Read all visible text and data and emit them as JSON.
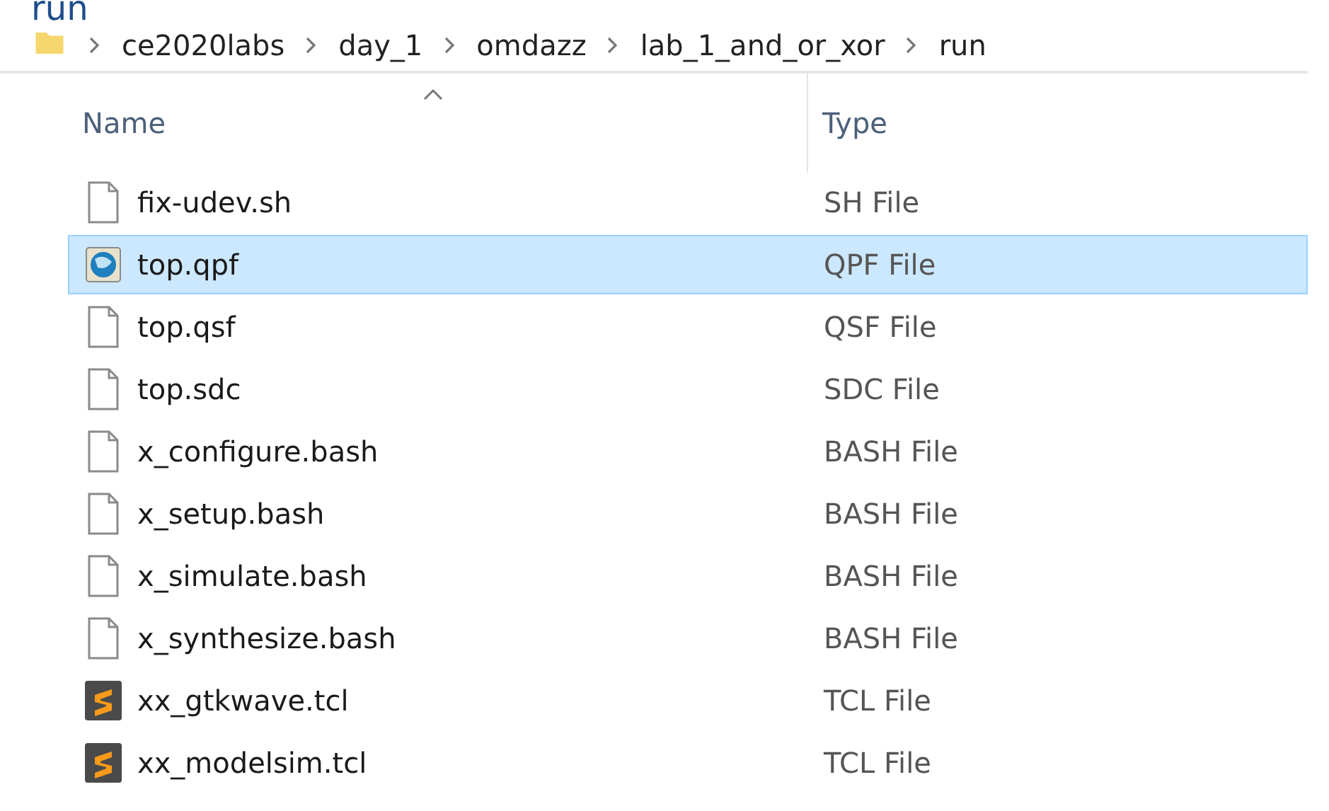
{
  "window": {
    "title": "run"
  },
  "breadcrumb": [
    "ce2020labs",
    "day_1",
    "omdazz",
    "lab_1_and_or_xor",
    "run"
  ],
  "table": {
    "columns": [
      {
        "label": "Name",
        "sorted": true
      },
      {
        "label": "Type",
        "sorted": false
      }
    ],
    "rows": [
      {
        "name": "fix-udev.sh",
        "type": "SH File",
        "kind": "plain",
        "selected": false
      },
      {
        "name": "top.qpf",
        "type": "QPF File",
        "kind": "quartus",
        "selected": true
      },
      {
        "name": "top.qsf",
        "type": "QSF File",
        "kind": "plain",
        "selected": false
      },
      {
        "name": "top.sdc",
        "type": "SDC File",
        "kind": "plain",
        "selected": false
      },
      {
        "name": "x_configure.bash",
        "type": "BASH File",
        "kind": "plain",
        "selected": false
      },
      {
        "name": "x_setup.bash",
        "type": "BASH File",
        "kind": "plain",
        "selected": false
      },
      {
        "name": "x_simulate.bash",
        "type": "BASH File",
        "kind": "plain",
        "selected": false
      },
      {
        "name": "x_synthesize.bash",
        "type": "BASH File",
        "kind": "plain",
        "selected": false
      },
      {
        "name": "xx_gtkwave.tcl",
        "type": "TCL File",
        "kind": "sublime",
        "selected": false
      },
      {
        "name": "xx_modelsim.tcl",
        "type": "TCL File",
        "kind": "sublime",
        "selected": false
      }
    ]
  }
}
